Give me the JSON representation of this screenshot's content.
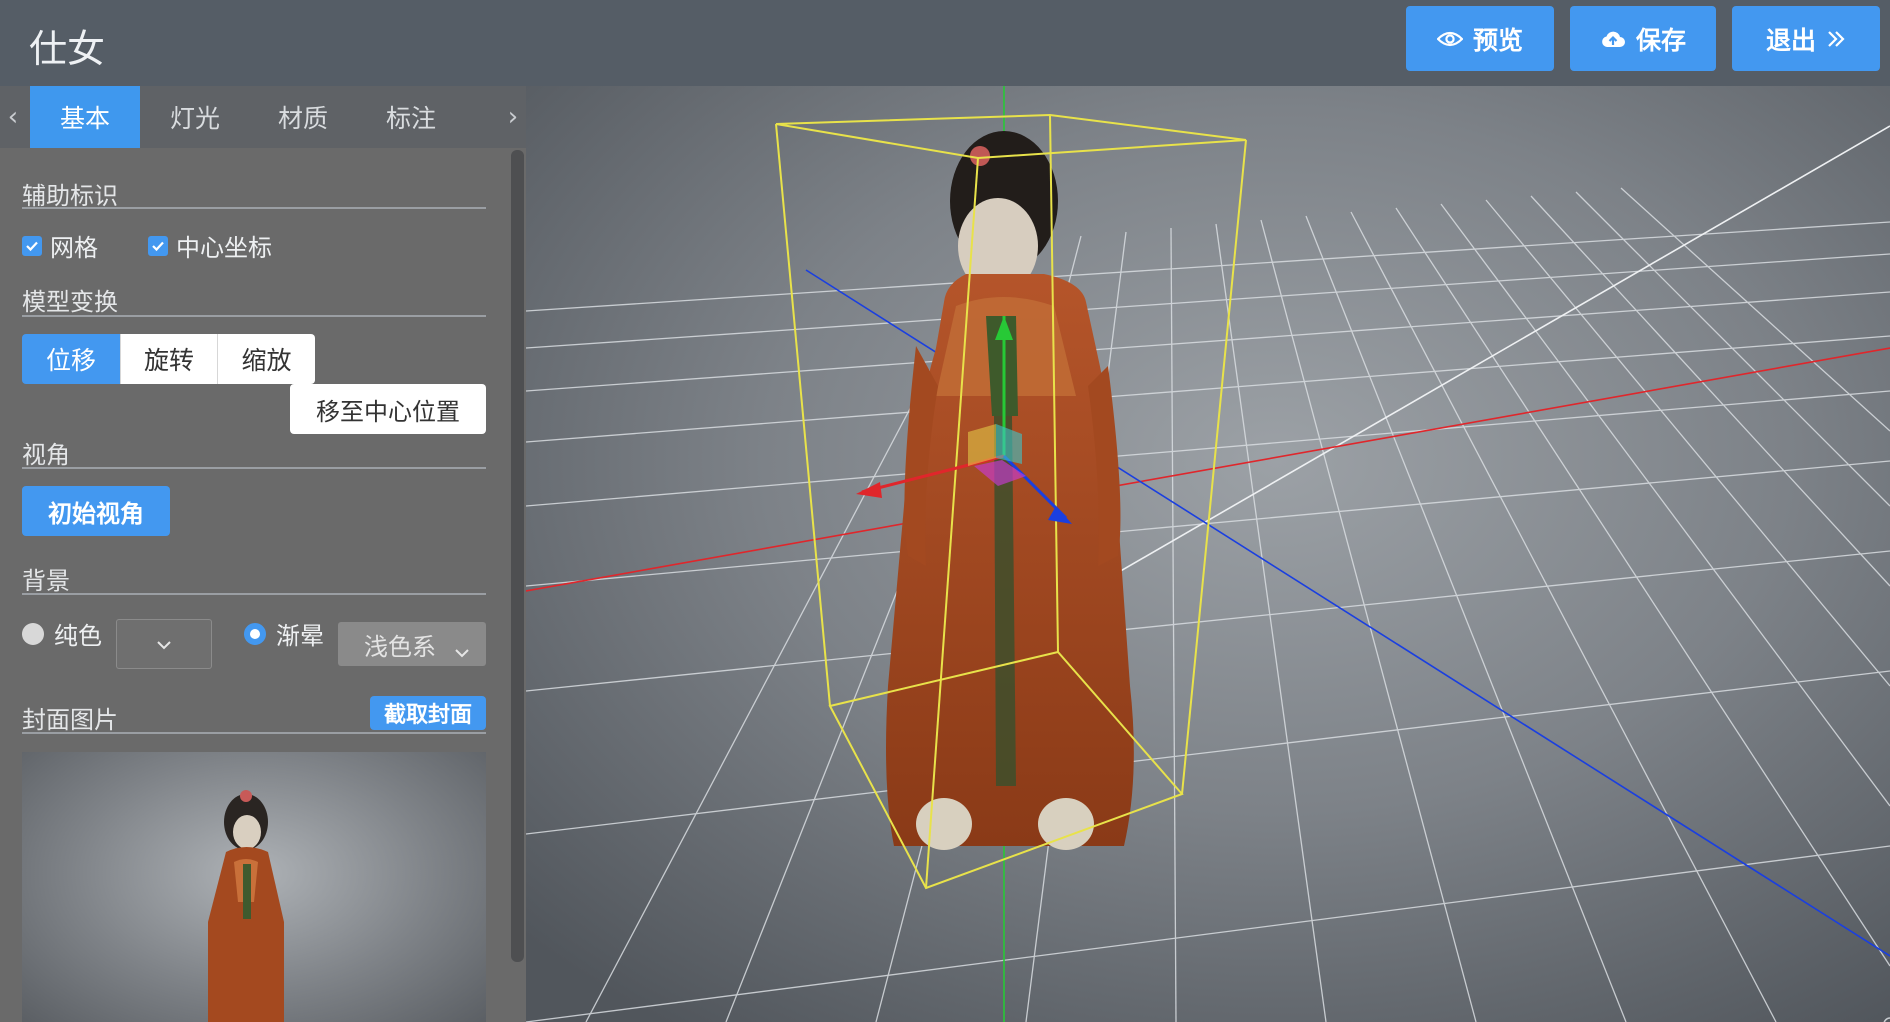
{
  "header": {
    "title": "仕女",
    "buttons": {
      "preview": "预览",
      "save": "保存",
      "exit": "退出"
    }
  },
  "tabs": [
    "基本",
    "灯光",
    "材质",
    "标注"
  ],
  "panel": {
    "aux": {
      "title": "辅助标识",
      "grid": "网格",
      "center_axis": "中心坐标"
    },
    "transform": {
      "title": "模型变换",
      "move": "位移",
      "rotate": "旋转",
      "scale": "缩放",
      "center": "移至中心位置"
    },
    "view": {
      "title": "视角",
      "initial": "初始视角"
    },
    "background": {
      "title": "背景",
      "solid": "纯色",
      "gradient": "渐晕",
      "gradient_value": "浅色系"
    },
    "cover": {
      "title": "封面图片",
      "capture": "截取封面"
    }
  },
  "state": {
    "active_tab": "基本",
    "grid_checked": true,
    "center_axis_checked": true,
    "transform_mode": "位移",
    "background_mode": "渐晕"
  },
  "colors": {
    "accent": "#4398f0",
    "panel_bg": "#6a6a6a",
    "header_bg": "#555d66",
    "bbox": "#e8e24a",
    "x_axis": "#e0262b",
    "y_axis": "#27c936",
    "z_axis": "#1a3fe0"
  },
  "icons": {
    "preview": "eye-icon",
    "save": "cloud-upload-icon",
    "exit": "double-chevron-right-icon",
    "search": "search-icon"
  }
}
